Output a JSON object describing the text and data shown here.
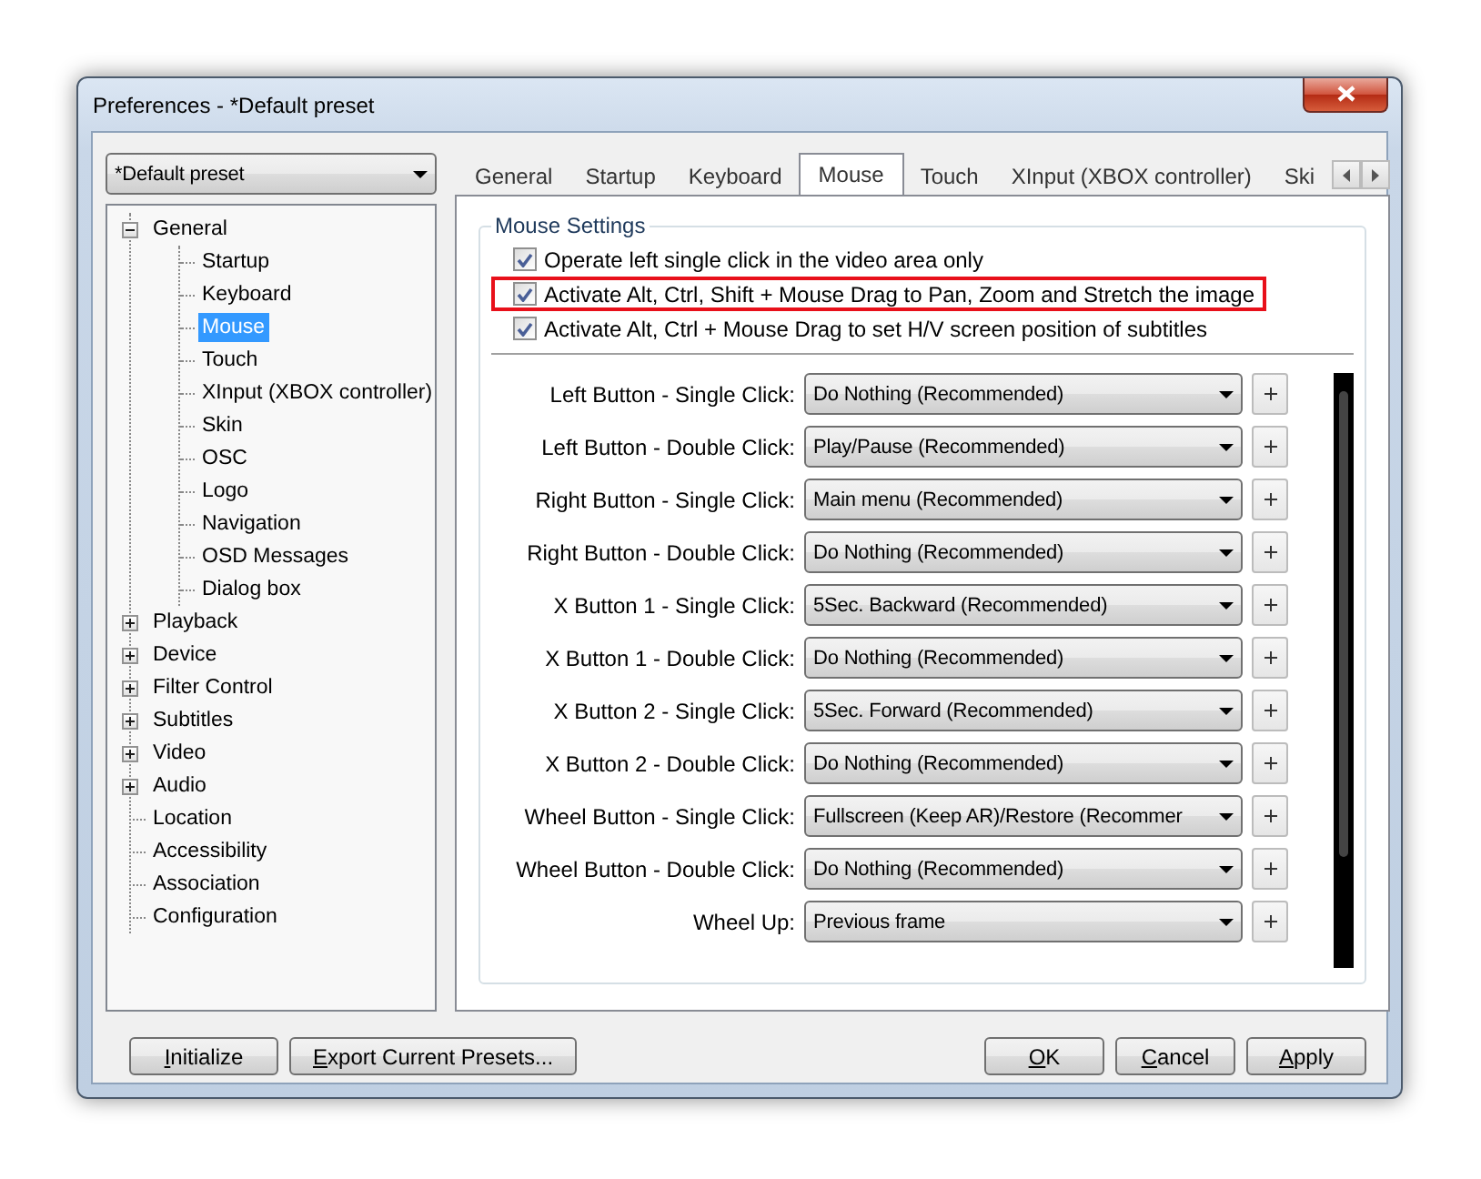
{
  "window": {
    "title": "Preferences - *Default preset"
  },
  "preset": {
    "value": "*Default preset"
  },
  "tree": [
    {
      "label": "General",
      "expanded": true,
      "selected": false,
      "children": [
        {
          "label": "Startup",
          "selected": false
        },
        {
          "label": "Keyboard",
          "selected": false
        },
        {
          "label": "Mouse",
          "selected": true
        },
        {
          "label": "Touch",
          "selected": false
        },
        {
          "label": "XInput (XBOX controller)",
          "selected": false
        },
        {
          "label": "Skin",
          "selected": false
        },
        {
          "label": "OSC",
          "selected": false
        },
        {
          "label": "Logo",
          "selected": false
        },
        {
          "label": "Navigation",
          "selected": false
        },
        {
          "label": "OSD Messages",
          "selected": false
        },
        {
          "label": "Dialog box",
          "selected": false
        }
      ]
    },
    {
      "label": "Playback",
      "expanded": false,
      "selected": false
    },
    {
      "label": "Device",
      "expanded": false,
      "selected": false
    },
    {
      "label": "Filter Control",
      "expanded": false,
      "selected": false
    },
    {
      "label": "Subtitles",
      "expanded": false,
      "selected": false
    },
    {
      "label": "Video",
      "expanded": false,
      "selected": false
    },
    {
      "label": "Audio",
      "expanded": false,
      "selected": false
    },
    {
      "label": "Location",
      "selected": false
    },
    {
      "label": "Accessibility",
      "selected": false
    },
    {
      "label": "Association",
      "selected": false
    },
    {
      "label": "Configuration",
      "selected": false
    }
  ],
  "tabs": [
    {
      "label": "General",
      "selected": false
    },
    {
      "label": "Startup",
      "selected": false
    },
    {
      "label": "Keyboard",
      "selected": false
    },
    {
      "label": "Mouse",
      "selected": true
    },
    {
      "label": "Touch",
      "selected": false
    },
    {
      "label": "XInput (XBOX controller)",
      "selected": false
    },
    {
      "label": "Ski",
      "selected": false
    }
  ],
  "group": {
    "title": "Mouse Settings",
    "options": [
      {
        "label": "Operate left single click in the video area only",
        "checked": true,
        "highlighted": false
      },
      {
        "label": "Activate Alt, Ctrl, Shift + Mouse Drag to Pan, Zoom and Stretch the image",
        "checked": true,
        "highlighted": true
      },
      {
        "label": "Activate Alt, Ctrl + Mouse Drag to set H/V screen position of subtitles",
        "checked": true,
        "highlighted": false
      }
    ],
    "actions": [
      {
        "label": "Left Button - Single Click:",
        "value": "Do Nothing (Recommended)"
      },
      {
        "label": "Left Button - Double Click:",
        "value": "Play/Pause (Recommended)"
      },
      {
        "label": "Right Button - Single Click:",
        "value": "Main menu (Recommended)"
      },
      {
        "label": "Right Button - Double Click:",
        "value": "Do Nothing (Recommended)"
      },
      {
        "label": "X Button 1 - Single Click:",
        "value": "5Sec. Backward (Recommended)"
      },
      {
        "label": "X Button 1 - Double Click:",
        "value": "Do Nothing (Recommended)"
      },
      {
        "label": "X Button 2 - Single Click:",
        "value": "5Sec. Forward (Recommended)"
      },
      {
        "label": "X Button 2 - Double Click:",
        "value": "Do Nothing (Recommended)"
      },
      {
        "label": "Wheel Button - Single Click:",
        "value": "Fullscreen (Keep AR)/Restore (Recommer"
      },
      {
        "label": "Wheel Button - Double Click:",
        "value": "Do Nothing (Recommended)"
      },
      {
        "label": "Wheel Up:",
        "value": "Previous frame"
      }
    ]
  },
  "buttons_left": [
    "Initialize",
    "Export Current Presets..."
  ],
  "buttons_right": [
    "OK",
    "Cancel",
    "Apply"
  ]
}
